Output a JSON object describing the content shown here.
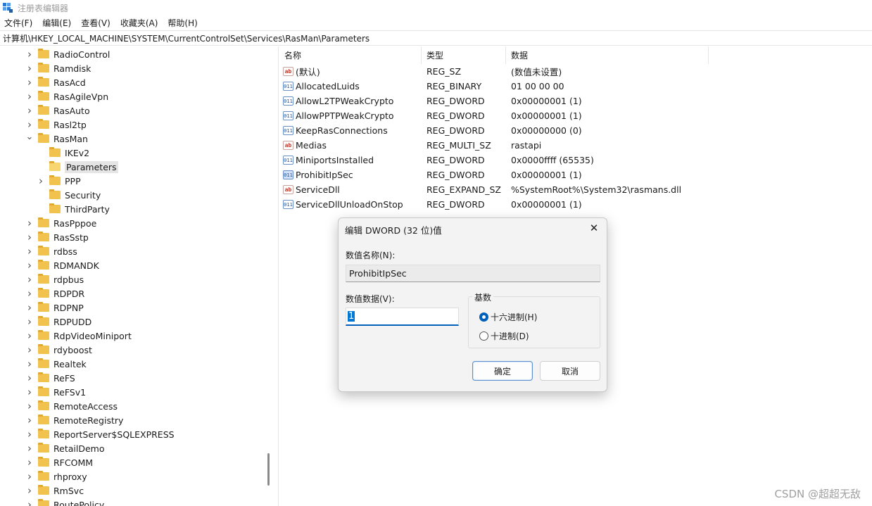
{
  "window": {
    "title": "注册表编辑器"
  },
  "menu": [
    "文件(F)",
    "编辑(E)",
    "查看(V)",
    "收藏夹(A)",
    "帮助(H)"
  ],
  "address": "计算机\\HKEY_LOCAL_MACHINE\\SYSTEM\\CurrentControlSet\\Services\\RasMan\\Parameters",
  "tree": [
    {
      "label": "RadioControl",
      "level": 1,
      "chevron": "right"
    },
    {
      "label": "Ramdisk",
      "level": 1,
      "chevron": "right"
    },
    {
      "label": "RasAcd",
      "level": 1,
      "chevron": "right"
    },
    {
      "label": "RasAgileVpn",
      "level": 1,
      "chevron": "right"
    },
    {
      "label": "RasAuto",
      "level": 1,
      "chevron": "right"
    },
    {
      "label": "Rasl2tp",
      "level": 1,
      "chevron": "right"
    },
    {
      "label": "RasMan",
      "level": 1,
      "chevron": "down"
    },
    {
      "label": "IKEv2",
      "level": 2,
      "chevron": "none"
    },
    {
      "label": "Parameters",
      "level": 2,
      "chevron": "none",
      "selected": true
    },
    {
      "label": "PPP",
      "level": 2,
      "chevron": "right"
    },
    {
      "label": "Security",
      "level": 2,
      "chevron": "none"
    },
    {
      "label": "ThirdParty",
      "level": 2,
      "chevron": "none"
    },
    {
      "label": "RasPppoe",
      "level": 1,
      "chevron": "right"
    },
    {
      "label": "RasSstp",
      "level": 1,
      "chevron": "right"
    },
    {
      "label": "rdbss",
      "level": 1,
      "chevron": "right"
    },
    {
      "label": "RDMANDK",
      "level": 1,
      "chevron": "right"
    },
    {
      "label": "rdpbus",
      "level": 1,
      "chevron": "right"
    },
    {
      "label": "RDPDR",
      "level": 1,
      "chevron": "right"
    },
    {
      "label": "RDPNP",
      "level": 1,
      "chevron": "right"
    },
    {
      "label": "RDPUDD",
      "level": 1,
      "chevron": "right"
    },
    {
      "label": "RdpVideoMiniport",
      "level": 1,
      "chevron": "right"
    },
    {
      "label": "rdyboost",
      "level": 1,
      "chevron": "right"
    },
    {
      "label": "Realtek",
      "level": 1,
      "chevron": "right"
    },
    {
      "label": "ReFS",
      "level": 1,
      "chevron": "right"
    },
    {
      "label": "ReFSv1",
      "level": 1,
      "chevron": "right"
    },
    {
      "label": "RemoteAccess",
      "level": 1,
      "chevron": "right"
    },
    {
      "label": "RemoteRegistry",
      "level": 1,
      "chevron": "right"
    },
    {
      "label": "ReportServer$SQLEXPRESS",
      "level": 1,
      "chevron": "right"
    },
    {
      "label": "RetailDemo",
      "level": 1,
      "chevron": "right"
    },
    {
      "label": "RFCOMM",
      "level": 1,
      "chevron": "right"
    },
    {
      "label": "rhproxy",
      "level": 1,
      "chevron": "right"
    },
    {
      "label": "RmSvc",
      "level": 1,
      "chevron": "right"
    },
    {
      "label": "RoutePolicy",
      "level": 1,
      "chevron": "right"
    }
  ],
  "list": {
    "headers": {
      "name": "名称",
      "type": "类型",
      "data": "数据"
    },
    "rows": [
      {
        "icon": "sz",
        "name": "(默认)",
        "type": "REG_SZ",
        "data": "(数值未设置)"
      },
      {
        "icon": "bin",
        "name": "AllocatedLuids",
        "type": "REG_BINARY",
        "data": "01 00 00 00"
      },
      {
        "icon": "bin",
        "name": "AllowL2TPWeakCrypto",
        "type": "REG_DWORD",
        "data": "0x00000001 (1)"
      },
      {
        "icon": "bin",
        "name": "AllowPPTPWeakCrypto",
        "type": "REG_DWORD",
        "data": "0x00000001 (1)"
      },
      {
        "icon": "bin",
        "name": "KeepRasConnections",
        "type": "REG_DWORD",
        "data": "0x00000000 (0)"
      },
      {
        "icon": "sz",
        "name": "Medias",
        "type": "REG_MULTI_SZ",
        "data": "rastapi"
      },
      {
        "icon": "bin",
        "name": "MiniportsInstalled",
        "type": "REG_DWORD",
        "data": "0x0000ffff (65535)"
      },
      {
        "icon": "bin",
        "name": "ProhibitIpSec",
        "type": "REG_DWORD",
        "data": "0x00000001 (1)",
        "highlight": true
      },
      {
        "icon": "sz",
        "name": "ServiceDll",
        "type": "REG_EXPAND_SZ",
        "data": "%SystemRoot%\\System32\\rasmans.dll"
      },
      {
        "icon": "bin",
        "name": "ServiceDllUnloadOnStop",
        "type": "REG_DWORD",
        "data": "0x00000001 (1)"
      }
    ]
  },
  "dialog": {
    "title": "编辑 DWORD (32 位)值",
    "name_label": "数值名称(N):",
    "name_value": "ProhibitIpSec",
    "data_label": "数值数据(V):",
    "data_value": "1",
    "base_label": "基数",
    "hex_label": "十六进制(H)",
    "dec_label": "十进制(D)",
    "selected_base": "hex",
    "ok_label": "确定",
    "cancel_label": "取消"
  },
  "watermark": "CSDN @超超无敌",
  "colors": {
    "accent": "#005fb8",
    "folder": "#f2c24f",
    "selection": "#e5e5e5"
  },
  "icons": {
    "app": "regedit-icon",
    "close": "close-icon",
    "string_value": "ab-string-icon",
    "binary_value": "binary-value-icon",
    "folder": "folder-icon"
  }
}
